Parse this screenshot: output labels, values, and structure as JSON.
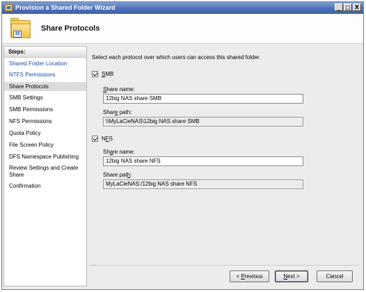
{
  "window": {
    "title": "Provision a Shared Folder Wizard",
    "minimize": "_",
    "maximize": "□",
    "close": "X"
  },
  "header": {
    "title": "Share Protocols"
  },
  "steps": {
    "heading": "Steps:",
    "items": [
      {
        "label": "Shared Folder Location",
        "state": "done"
      },
      {
        "label": "NTFS Permissions",
        "state": "done"
      },
      {
        "label": "Share Protocols",
        "state": "current"
      },
      {
        "label": "SMB Settings",
        "state": "pending"
      },
      {
        "label": "SMB Permissions",
        "state": "pending"
      },
      {
        "label": "NFS Permissions",
        "state": "pending"
      },
      {
        "label": "Quota Policy",
        "state": "pending"
      },
      {
        "label": "File Screen Policy",
        "state": "pending"
      },
      {
        "label": "DFS Namespace Publishing",
        "state": "pending"
      },
      {
        "label": "Review Settings and Create Share",
        "state": "pending"
      },
      {
        "label": "Confirmation",
        "state": "pending"
      }
    ]
  },
  "main": {
    "intro": "Select each protocol over which users can access this shared folder.",
    "smb": {
      "checked": true,
      "label_accel": "S",
      "label_rest": "MB",
      "share_name_accel": "S",
      "share_name_rest": "hare name:",
      "share_name_value": "12big NAS share SMB",
      "share_path_pre": "Shar",
      "share_path_accel": "e",
      "share_path_post": " path:",
      "share_path_value": "\\\\MyLaCieNAS\\12big NAS share SMB"
    },
    "nfs": {
      "checked": true,
      "label_pre": "N",
      "label_accel": "F",
      "label_post": "S",
      "share_name_pre": "Sh",
      "share_name_accel": "a",
      "share_name_post": "re name:",
      "share_name_value": "12big NAS share NFS",
      "share_path_pre": "Share pat",
      "share_path_accel": "h",
      "share_path_post": ":",
      "share_path_value": "MyLaCieNAS:/12big NAS share NFS"
    }
  },
  "buttons": {
    "previous_pre": "< ",
    "previous_accel": "P",
    "previous_post": "revious",
    "next_accel": "N",
    "next_post": "ext >",
    "cancel": "Cancel"
  }
}
